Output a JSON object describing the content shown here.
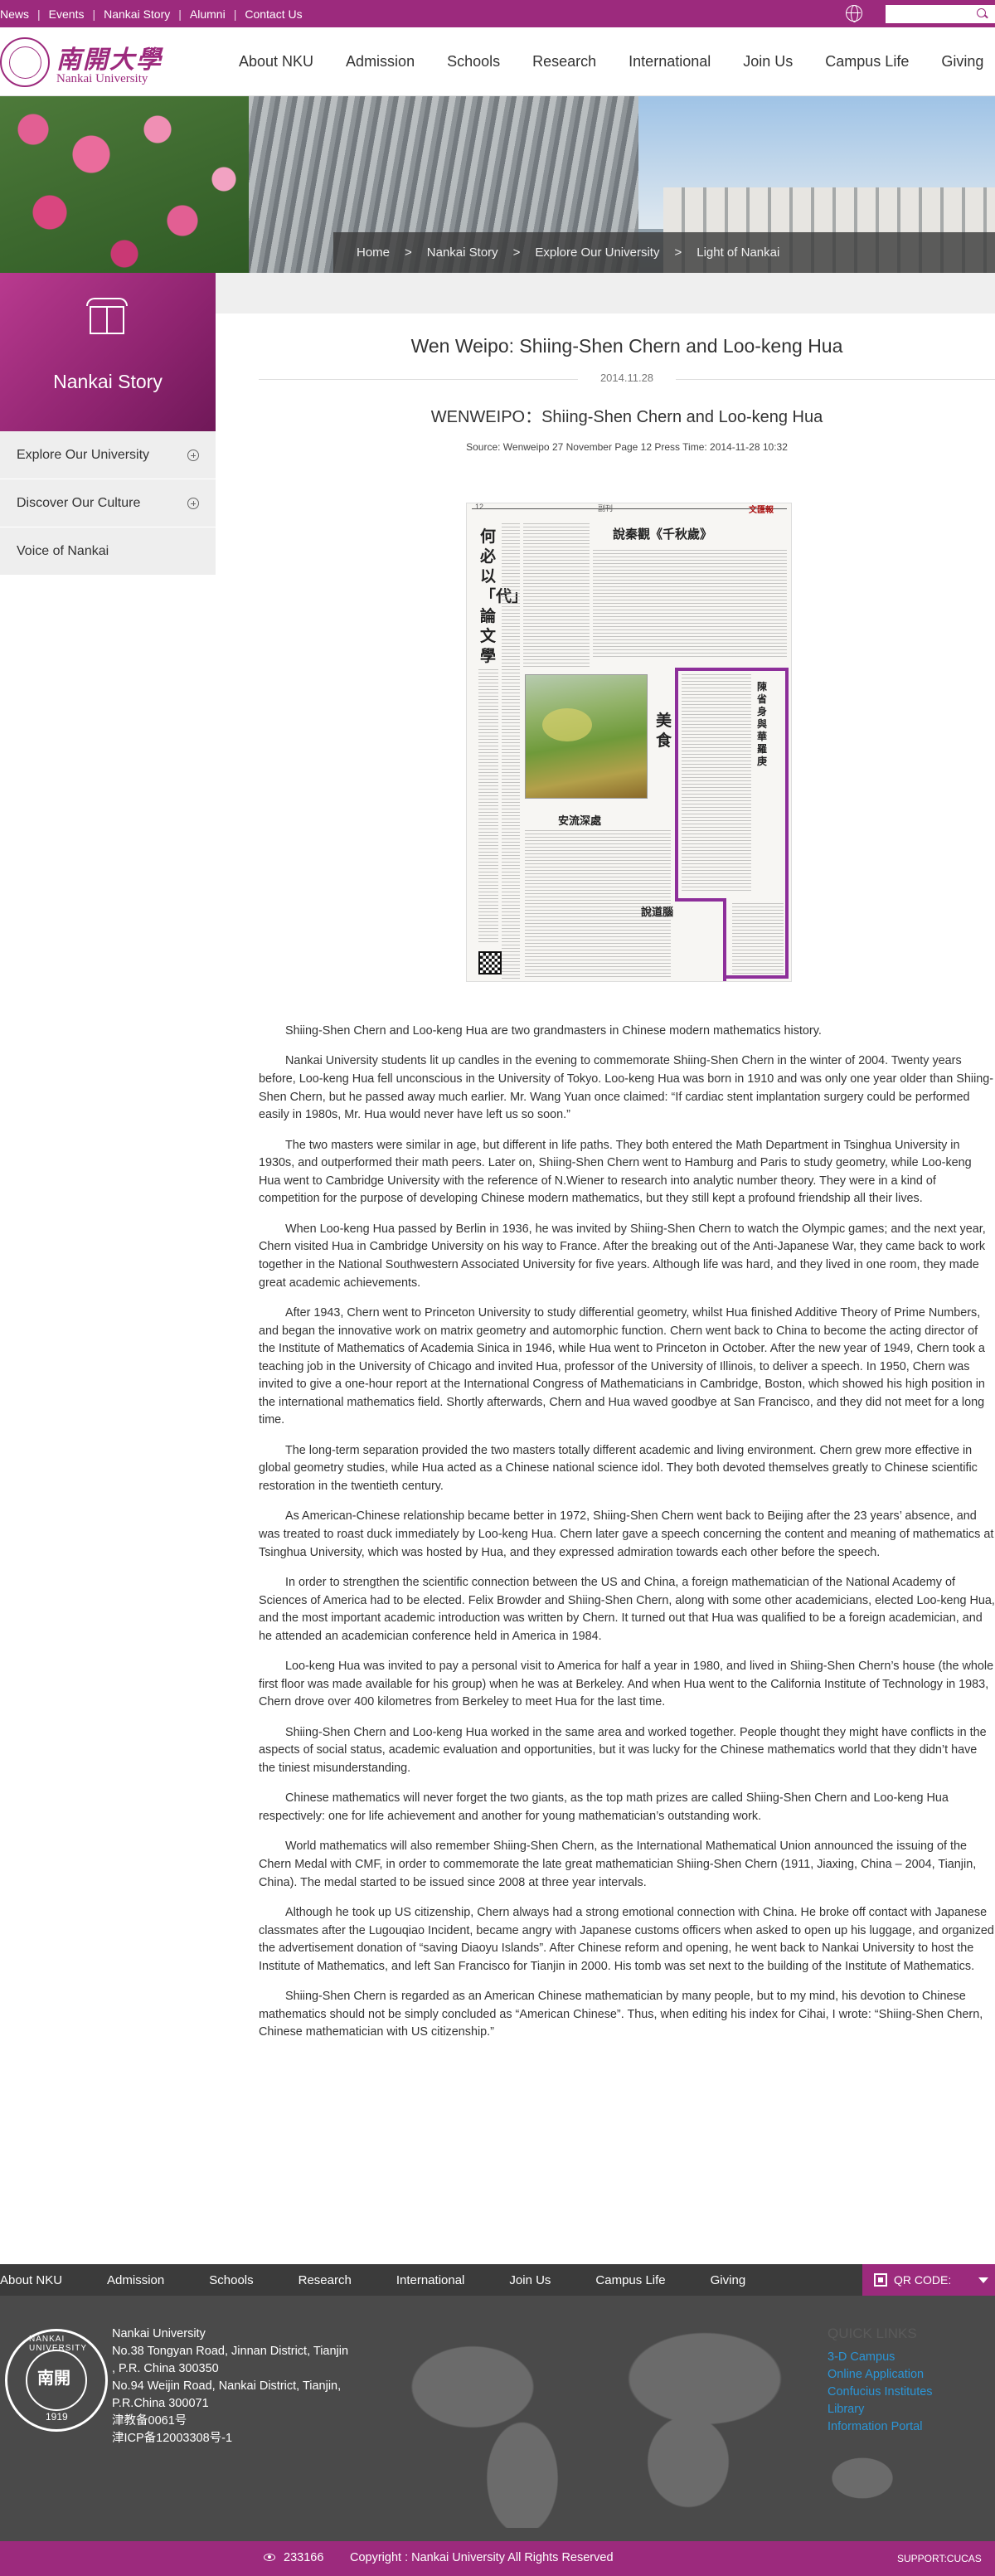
{
  "topbar": {
    "links": [
      "News",
      "Events",
      "Nankai Story",
      "Alumni",
      "Contact Us"
    ],
    "search_placeholder": ""
  },
  "header": {
    "logo_cn": "南開大學",
    "logo_en": "Nankai University",
    "nav": [
      "About NKU",
      "Admission",
      "Schools",
      "Research",
      "International",
      "Join Us",
      "Campus Life",
      "Giving"
    ]
  },
  "breadcrumb": [
    "Home",
    "Nankai Story",
    "Explore Our University",
    "Light of Nankai"
  ],
  "sidebar": {
    "title": "Nankai Story",
    "items": [
      {
        "label": "Explore Our University"
      },
      {
        "label": "Discover Our Culture"
      },
      {
        "label": "Voice of Nankai"
      }
    ]
  },
  "article": {
    "title": "Wen Weipo: Shiing-Shen Chern and Loo-keng Hua",
    "date": "2014.11.28",
    "subtitle": "WENWEIPO：Shiing-Shen Chern and Loo-keng Hua",
    "source": "Source: Wenweipo 27 November Page 12     Press Time: 2014-11-28 10:32",
    "newspaper": {
      "page_no": "12",
      "section": "副刊",
      "brand": "文匯報",
      "vertical_title": "何必以「代」論文學",
      "top_title": "說秦觀《千秋歲》",
      "big_char": "美食",
      "caption1": "安流深處",
      "caption2": "說道腦",
      "highlight_title": "陳省身與華羅庚"
    },
    "paragraphs": [
      "Shiing-Shen Chern and Loo-keng Hua are two grandmasters in Chinese modern mathematics history.",
      "Nankai University students lit up candles in the evening to commemorate Shiing-Shen Chern in the winter of 2004. Twenty years before, Loo-keng Hua fell unconscious in the University of Tokyo. Loo-keng Hua was born in 1910 and was only one year older than Shiing-Shen Chern, but he passed away much earlier. Mr. Wang Yuan once claimed: “If cardiac stent implantation surgery could be performed easily in 1980s, Mr. Hua would never have left us so soon.”",
      "The two masters were similar in age, but different in life paths. They both entered the Math Department in Tsinghua University in 1930s, and outperformed their math peers. Later on, Shiing-Shen Chern went to Hamburg and Paris to study geometry, while Loo-keng Hua went to Cambridge University with the reference of N.Wiener to research into analytic number theory. They were in a kind of competition for the purpose of developing Chinese modern mathematics, but they still kept a profound friendship all their lives.",
      "When Loo-keng Hua passed by Berlin in 1936, he was invited by Shiing-Shen Chern to watch the Olympic games; and the next year, Chern visited Hua in Cambridge University on his way to France. After the breaking out of the Anti-Japanese War, they came back to work together in the National Southwestern Associated University for five years. Although life was hard, and they lived in one room, they made great academic achievements.",
      "After 1943, Chern went to Princeton University to study differential geometry, whilst Hua finished Additive Theory of Prime Numbers, and began the innovative work on matrix geometry and automorphic function. Chern went back to China to become the acting director of the Institute of Mathematics of Academia Sinica in 1946, while Hua went to Princeton in October. After the new year of 1949, Chern took a teaching job in the University of Chicago and invited Hua, professor of the University of Illinois, to deliver a speech. In 1950, Chern was invited to give a one-hour report at the International Congress of Mathematicians in Cambridge, Boston, which showed his high position in the international mathematics field. Shortly afterwards, Chern and Hua waved goodbye at San Francisco, and they did not meet for a long time.",
      "The long-term separation provided the two masters totally different academic and living environment. Chern grew more effective in global geometry studies, while Hua acted as a Chinese national science idol. They both devoted themselves greatly to Chinese scientific restoration in the twentieth century.",
      "As American-Chinese relationship became better in 1972, Shiing-Shen Chern went back to Beijing after the 23 years’ absence, and was treated to roast duck immediately by Loo-keng Hua. Chern later gave a speech concerning the content and meaning of mathematics at Tsinghua University, which was hosted by Hua, and they expressed admiration towards each other before the speech.",
      "In order to strengthen the scientific connection between the US and China, a foreign mathematician of the National Academy of Sciences of America had to be elected. Felix Browder and Shiing-Shen Chern, along with some other academicians, elected Loo-keng Hua, and the most important academic introduction was written by Chern. It turned out that Hua was qualified to be a foreign academician, and he attended an academician conference held in America in 1984.",
      "Loo-keng Hua was invited to pay a personal visit to America for half a year in 1980, and lived in Shiing-Shen Chern’s house (the whole first floor was made available for his group) when he was at Berkeley. And when Hua went to the California Institute of Technology in 1983, Chern drove over 400 kilometres from Berkeley to meet Hua for the last time.",
      "Shiing-Shen Chern and Loo-keng Hua worked in the same area and worked together. People thought they might have conflicts in the aspects of social status, academic evaluation and opportunities, but it was lucky for the Chinese mathematics world that they didn’t have the tiniest misunderstanding.",
      "Chinese mathematics will never forget the two giants, as the top math prizes are called Shiing-Shen Chern and Loo-keng Hua respectively: one for life achievement and another for young mathematician’s outstanding work.",
      "World mathematics will also remember Shiing-Shen Chern, as the International Mathematical Union announced the issuing of the Chern Medal with CMF, in order to commemorate the late great mathematician Shiing-Shen Chern (1911, Jiaxing, China – 2004, Tianjin, China). The medal started to be issued since 2008 at three year intervals.",
      "Although he took up US citizenship, Chern always had a strong emotional connection with China. He broke off contact with Japanese classmates after the Lugouqiao Incident, became angry with Japanese customs officers when asked to open up his luggage, and organized the advertisement donation of “saving Diaoyu Islands”. After Chinese reform and opening, he went back to Nankai University to host the Institute of Mathematics, and left San Francisco for Tianjin in 2000. His tomb was set next to the building of the Institute of Mathematics.",
      "Shiing-Shen Chern is regarded as an American Chinese mathematician by many people, but to my mind, his devotion to Chinese mathematics should not be simply concluded as “American Chinese”. Thus, when editing his index for Cihai, I wrote: “Shiing-Shen Chern, Chinese mathematician with US citizenship.”"
    ]
  },
  "footer_nav": {
    "items": [
      "About NKU",
      "Admission",
      "Schools",
      "Research",
      "International",
      "Join Us",
      "Campus Life",
      "Giving"
    ],
    "qr_label": "QR CODE:"
  },
  "footer": {
    "seal_text": "NANKAI UNIVERSITY",
    "seal_mid": "南開",
    "seal_year": "1919",
    "address": [
      "Nankai University",
      "No.38 Tongyan Road, Jinnan District, Tianjin",
      " , P.R. China 300350",
      "No.94 Weijin Road,  Nankai District, Tianjin,",
      "P.R.China  300071",
      "津教备0061号",
      "津ICP备12003308号-1"
    ],
    "quick_links_title": "QUICK LINKS",
    "quick_links": [
      "3-D Campus",
      "Online Application",
      "Confucius Institutes",
      "Library",
      "Information Portal"
    ]
  },
  "bottom": {
    "visits": "233166",
    "copyright": "Copyright : Nankai University All Rights Reserved",
    "support": "SUPPORT:CUCAS"
  },
  "colors": {
    "brand_purple": "#9c2a7d",
    "footer_gray": "#4a4a4a",
    "link_blue": "#2b95d6"
  }
}
